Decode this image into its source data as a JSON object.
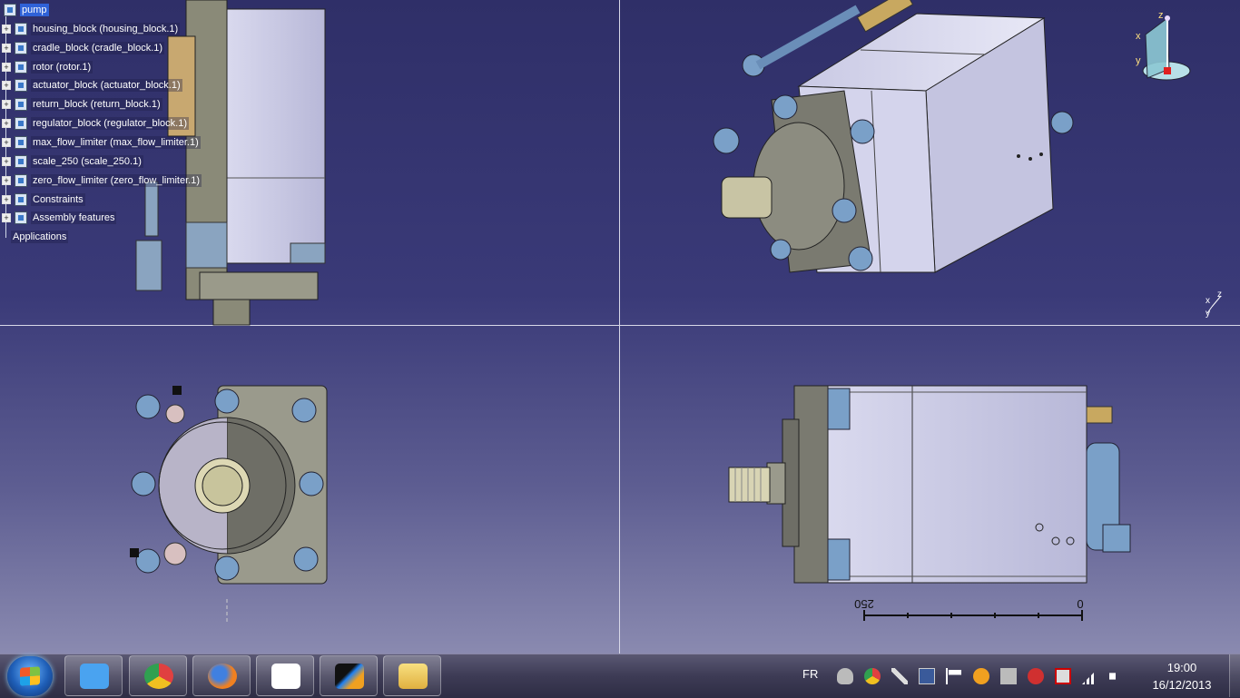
{
  "tree": {
    "root": "pump",
    "items": [
      {
        "label": "housing_block (housing_block.1)"
      },
      {
        "label": "cradle_block (cradle_block.1)"
      },
      {
        "label": "rotor (rotor.1)"
      },
      {
        "label": "actuator_block (actuator_block.1)"
      },
      {
        "label": "return_block (return_block.1)"
      },
      {
        "label": "regulator_block (regulator_block.1)"
      },
      {
        "label": "max_flow_limiter (max_flow_limiter.1)"
      },
      {
        "label": "scale_250 (scale_250.1)"
      },
      {
        "label": "zero_flow_limiter (zero_flow_limiter.1)"
      },
      {
        "label": "Constraints"
      },
      {
        "label": "Assembly features"
      }
    ],
    "applications": "Applications"
  },
  "compass": {
    "z": "z",
    "x": "x",
    "y": "y"
  },
  "axis_small": {
    "x": "x",
    "y": "y",
    "z": "z"
  },
  "scale": {
    "left": "250",
    "right": "0"
  },
  "taskbar": {
    "apps": [
      {
        "name": "media-player-icon",
        "color": "#4aa3f0"
      },
      {
        "name": "chrome-icon",
        "color": "#e04040"
      },
      {
        "name": "firefox-icon",
        "color": "#f08020"
      },
      {
        "name": "metro-apps-icon",
        "color": "#ffffff"
      },
      {
        "name": "catia-icon",
        "color": "#2060c0"
      },
      {
        "name": "explorer-icon",
        "color": "#f0c040"
      }
    ],
    "language": "FR",
    "time": "19:00",
    "date": "16/12/2013"
  }
}
